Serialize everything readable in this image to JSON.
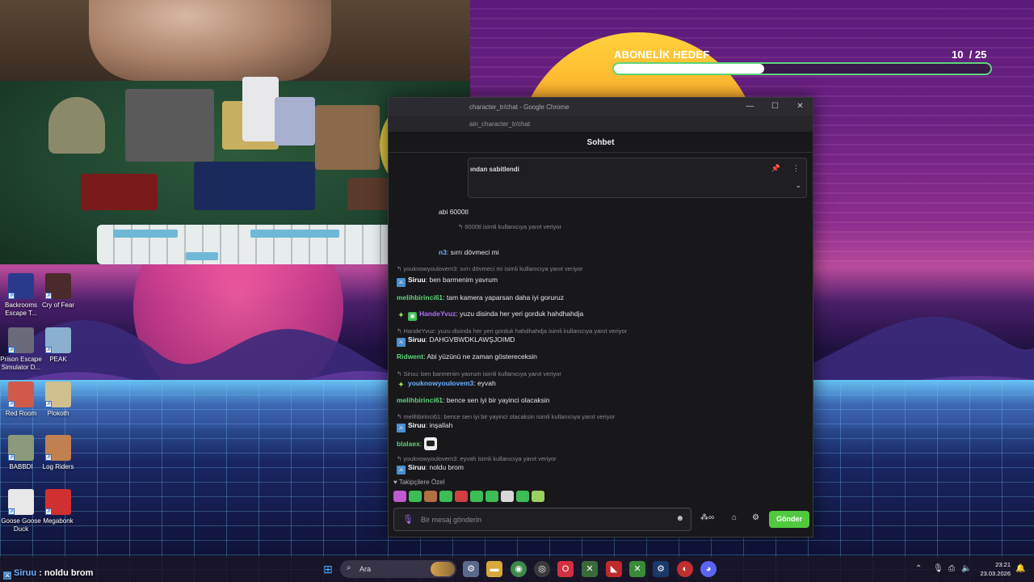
{
  "goal": {
    "title": "ABONELİK HEDEF",
    "current": "10",
    "total": "/ 25",
    "fraction": 0.4
  },
  "desktop_icons": [
    {
      "label": "Backrooms Escape T...",
      "color": "#2a3a8a"
    },
    {
      "label": "Cry of Fear",
      "color": "#4a2a2a"
    },
    {
      "label": "Prison Escape Simulator D...",
      "color": "#6a6a7a"
    },
    {
      "label": "PEAK",
      "color": "#8ab0d0"
    },
    {
      "label": "Red Room",
      "color": "#d05a4a"
    },
    {
      "label": "Plokoth",
      "color": "#d0c090"
    },
    {
      "label": "BABBDI",
      "color": "#8a9a7a"
    },
    {
      "label": "Log Riders",
      "color": "#c08050"
    },
    {
      "label": "Goose Goose Duck",
      "color": "#e8e8e8"
    },
    {
      "label": "Megabonk",
      "color": "#d03030"
    }
  ],
  "window": {
    "title": "character_tr/chat - Google Chrome",
    "url": "ain_character_tr/chat",
    "controls": {
      "minimize": "—",
      "maximize": "☐",
      "close": "✕"
    },
    "header": "Sohbet",
    "pinned": "ından sabitlendi"
  },
  "messages": [
    {
      "kind": "line",
      "user": "",
      "text": "abi 6000tl",
      "color": ""
    },
    {
      "kind": "reply",
      "text": "6000tl isimli kullanıcıya yanıt veriyor"
    },
    {
      "kind": "line",
      "user": "n3",
      "text": "sırrı dövmeci mi",
      "color": "#6fb0ff"
    },
    {
      "kind": "reply",
      "text": "youknowyoulovem3: sırrı dövmeci mi isimli kullanıcıya yanıt veriyor"
    },
    {
      "kind": "line",
      "user": "Siruu",
      "text": "ben barmenim yavrum",
      "color": "#ffffff",
      "badge": "mod"
    },
    {
      "kind": "line",
      "user": "melihbirinci61",
      "text": "tam kamera yaparsan daha iyi goruruz",
      "color": "#5fd47a"
    },
    {
      "kind": "line",
      "user": "HandeYvuz",
      "text": "yuzu disinda her yeri gorduk hahdhahdja",
      "color": "#b06bff",
      "badge": "spark-sub"
    },
    {
      "kind": "reply",
      "text": "HandeYvuz: yuzu disinda her yeri gorduk hahdhahdja isimli kullanıcıya yanıt veriyor"
    },
    {
      "kind": "line",
      "user": "Siruu",
      "text": "DAHGVBWDKLAWŞJOIMD",
      "color": "#ffffff",
      "badge": "mod"
    },
    {
      "kind": "line",
      "user": "Ridwent",
      "text": "Abi yüzünü ne zaman göstereceksin",
      "color": "#5fd47a"
    },
    {
      "kind": "reply",
      "text": "Siruu: ben barmenim yavrum isimli kullanıcıya yanıt veriyor"
    },
    {
      "kind": "line",
      "user": "youknowyoulovem3",
      "text": "eyvah",
      "color": "#6fb0ff",
      "badge": "spark"
    },
    {
      "kind": "line",
      "user": "melihbirinci61",
      "text": "bence sen iyi bir yayinci olacaksin",
      "color": "#5fd47a"
    },
    {
      "kind": "reply",
      "text": "melihbirinci61: bence sen iyi bir yayinci olacaksin isimli kullanıcıya yanıt veriyor"
    },
    {
      "kind": "line",
      "user": "Siruu",
      "text": "inşallah",
      "color": "#ffffff",
      "badge": "mod"
    },
    {
      "kind": "line",
      "user": "blalaex",
      "text": "",
      "color": "#5fd47a",
      "emote": true
    },
    {
      "kind": "reply",
      "text": "youknowyoulovem3: eyvah isimli kullanıcıya yanıt veriyor"
    },
    {
      "kind": "line",
      "user": "Siruu",
      "text": "noldu brom",
      "color": "#ffffff",
      "badge": "mod"
    }
  ],
  "followers_label": "Takipçilere Özel",
  "emote_colors": [
    "#c05ad0",
    "#3dbd55",
    "#b07040",
    "#3dbd55",
    "#d04040",
    "#3dbd55",
    "#3dbd55",
    "#d8d8d8",
    "#3dbd55",
    "#9ad060"
  ],
  "input": {
    "placeholder": "Bir mesaj gönderin"
  },
  "send_label": "Gönder",
  "overlay": {
    "user": "Siruu",
    "text": " : noldu brom"
  },
  "taskbar": {
    "search_placeholder": "Ara",
    "time": "23:21",
    "date": "23.03.2026"
  }
}
